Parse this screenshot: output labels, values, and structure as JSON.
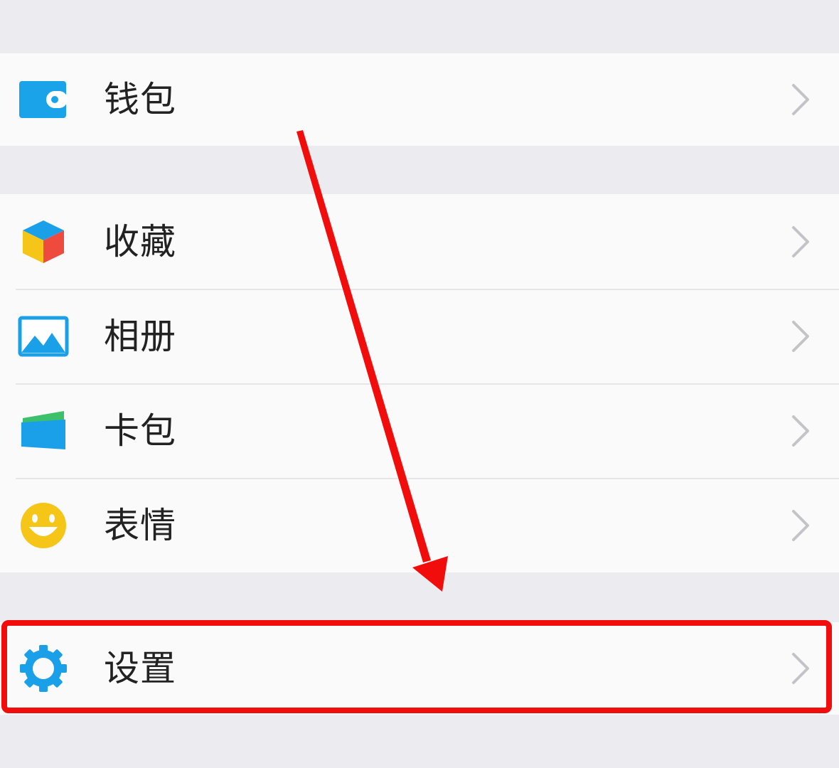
{
  "menu": {
    "items": [
      {
        "label": "钱包",
        "icon": "wallet-icon"
      },
      {
        "label": "收藏",
        "icon": "favorites-cube-icon"
      },
      {
        "label": "相册",
        "icon": "album-picture-icon"
      },
      {
        "label": "卡包",
        "icon": "card-wallet-icon"
      },
      {
        "label": "表情",
        "icon": "smiley-face-icon"
      },
      {
        "label": "设置",
        "icon": "gear-icon"
      }
    ]
  },
  "annotation": {
    "highlight_color": "#f20d0d",
    "highlighted_item": "设置"
  },
  "colors": {
    "background": "#efeff4",
    "row_background": "#fafafa",
    "accent_blue": "#1aa0e8",
    "separator": "#e6e6e9",
    "chevron": "#c4c4c8"
  }
}
